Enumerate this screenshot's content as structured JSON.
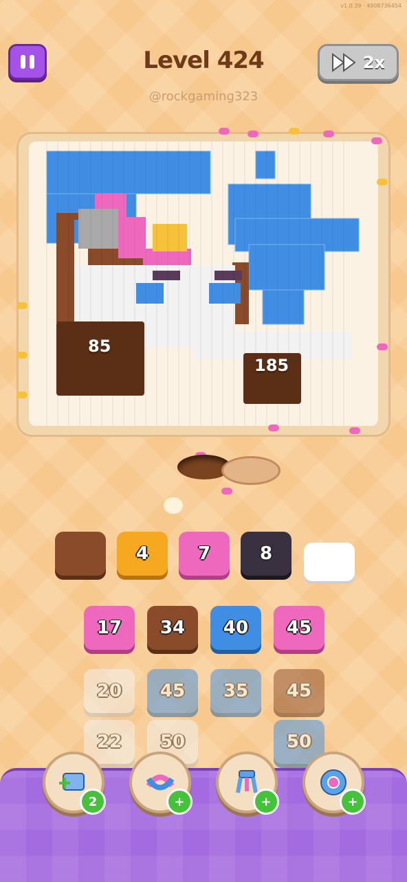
{
  "status": {
    "build": "v1.0.39 · 4908736454"
  },
  "header": {
    "level_title": "Level 424",
    "speed_label": "2x"
  },
  "watermark": "@rockgaming323",
  "board": {
    "left_stack_count": "85",
    "right_stack_count": "185"
  },
  "conveyor": [
    {
      "label": "",
      "color": "#8a4b2a"
    },
    {
      "label": "4",
      "color": "#f6a821"
    },
    {
      "label": "7",
      "color": "#ee68bd"
    },
    {
      "label": "8",
      "color": "#3a3140"
    },
    {
      "label": "",
      "color": "#ffffff"
    }
  ],
  "queue": {
    "row1": [
      "17",
      "34",
      "40",
      "45"
    ],
    "row2": [
      "20",
      "45",
      "35",
      "45"
    ],
    "row3": [
      "22",
      "50",
      "",
      "50"
    ]
  },
  "powerups": [
    {
      "icon": "add-slot-icon",
      "badge": "2"
    },
    {
      "icon": "shuffle-icon",
      "badge": "+"
    },
    {
      "icon": "claw-icon",
      "badge": "+"
    },
    {
      "icon": "magnet-icon",
      "badge": "+"
    }
  ],
  "colors": {
    "brown": "#8a4b2a",
    "pink": "#ee68bd",
    "blue": "#3f8ee3",
    "white": "#f2f2f2",
    "orange": "#f6a821",
    "dark": "#3a3140"
  }
}
